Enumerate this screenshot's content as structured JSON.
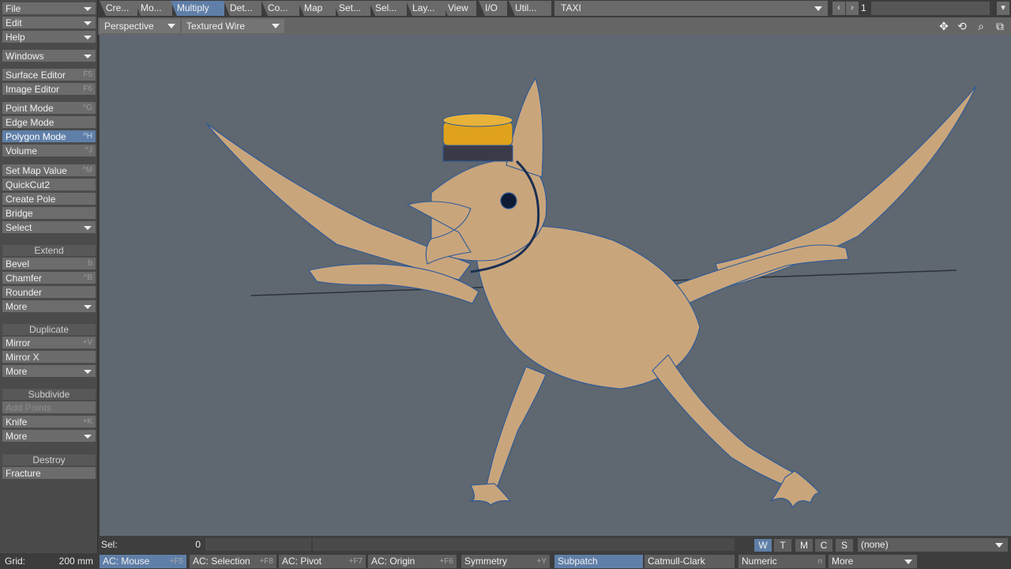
{
  "left_toolbar": {
    "file": "File",
    "edit": "Edit",
    "help": "Help",
    "windows": "Windows",
    "surface_editor": "Surface Editor",
    "surface_editor_sc": "F5",
    "image_editor": "Image Editor",
    "image_editor_sc": "F6",
    "point_mode": "Point Mode",
    "point_mode_sc": "^G",
    "edge_mode": "Edge Mode",
    "polygon_mode": "Polygon Mode",
    "polygon_mode_sc": "^H",
    "volume": "Volume",
    "volume_sc": "^J",
    "set_map_value": "Set Map Value",
    "set_map_value_sc": "^M",
    "quickcut2": "QuickCut2",
    "create_pole": "Create Pole",
    "bridge": "Bridge",
    "select": "Select",
    "extend_header": "Extend",
    "bevel": "Bevel",
    "bevel_sc": "b",
    "chamfer": "Chamfer",
    "chamfer_sc": "^B",
    "rounder": "Rounder",
    "more": "More",
    "duplicate_header": "Duplicate",
    "mirror": "Mirror",
    "mirror_sc": "+V",
    "mirror_x": "Mirror X",
    "subdivide_header": "Subdivide",
    "add_points": "Add Points",
    "knife": "Knife",
    "knife_sc": "+K",
    "destroy_header": "Destroy",
    "fracture": "Fracture"
  },
  "tabs": {
    "create": "Cre...",
    "modify": "Mo...",
    "multiply": "Multiply",
    "detail": "Det...",
    "construct": "Co...",
    "map": "Map",
    "setup": "Set...",
    "select": "Sel...",
    "layers": "Lay...",
    "view": "View",
    "io": "I/O",
    "utilities": "Util...",
    "object_name": "TAXI",
    "layer_number": "1"
  },
  "viewport": {
    "projection": "Perspective",
    "render_style": "Textured Wire"
  },
  "selbar": {
    "sel_label": "Sel:",
    "sel_value": "0",
    "w": "W",
    "t": "T",
    "m": "M",
    "c": "C",
    "s": "S",
    "vmap": "(none)"
  },
  "bottombar": {
    "grid_label": "Grid:",
    "grid_value": "200 mm",
    "ac_mouse": "AC: Mouse",
    "ac_mouse_sc": "+F5",
    "ac_selection": "AC: Selection",
    "ac_selection_sc": "+F8",
    "ac_pivot": "AC: Pivot",
    "ac_pivot_sc": "+F7",
    "ac_origin": "AC: Origin",
    "ac_origin_sc": "+F6",
    "symmetry": "Symmetry",
    "symmetry_sc": "+Y",
    "subpatch": "Subpatch",
    "catmull": "Catmull-Clark",
    "numeric": "Numeric",
    "numeric_sc": "n",
    "more": "More"
  },
  "colors": {
    "accent": "#5f7fa8",
    "viewport_bg": "#5f6770",
    "model_skin": "#c9a57c",
    "wire": "#2a5a9a",
    "hat_yellow": "#e0a21c"
  }
}
